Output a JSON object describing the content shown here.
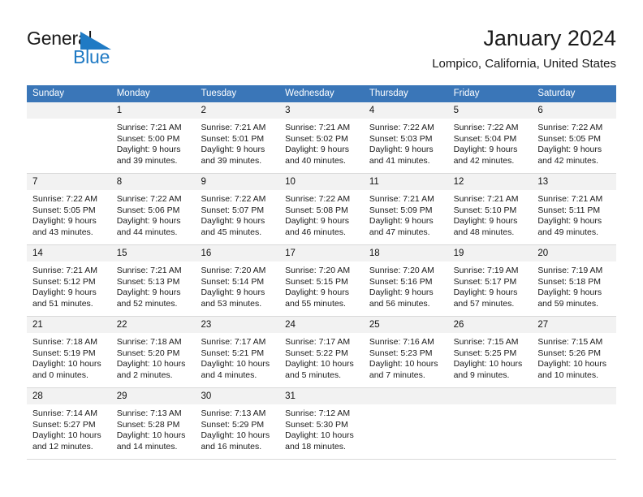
{
  "brand": {
    "name_part1": "General",
    "name_part2": "Blue",
    "logo_icon": "triangle-flag-icon",
    "accent_color": "#1f7ac4"
  },
  "header": {
    "title": "January 2024",
    "location": "Lompico, California, United States"
  },
  "calendar": {
    "header_color": "#3a76b8",
    "daynum_band_color": "#f2f2f2",
    "weekday_headers": [
      "Sunday",
      "Monday",
      "Tuesday",
      "Wednesday",
      "Thursday",
      "Friday",
      "Saturday"
    ],
    "weeks": [
      [
        {
          "day": "",
          "lines": []
        },
        {
          "day": "1",
          "lines": [
            "Sunrise: 7:21 AM",
            "Sunset: 5:00 PM",
            "Daylight: 9 hours",
            "and 39 minutes."
          ]
        },
        {
          "day": "2",
          "lines": [
            "Sunrise: 7:21 AM",
            "Sunset: 5:01 PM",
            "Daylight: 9 hours",
            "and 39 minutes."
          ]
        },
        {
          "day": "3",
          "lines": [
            "Sunrise: 7:21 AM",
            "Sunset: 5:02 PM",
            "Daylight: 9 hours",
            "and 40 minutes."
          ]
        },
        {
          "day": "4",
          "lines": [
            "Sunrise: 7:22 AM",
            "Sunset: 5:03 PM",
            "Daylight: 9 hours",
            "and 41 minutes."
          ]
        },
        {
          "day": "5",
          "lines": [
            "Sunrise: 7:22 AM",
            "Sunset: 5:04 PM",
            "Daylight: 9 hours",
            "and 42 minutes."
          ]
        },
        {
          "day": "6",
          "lines": [
            "Sunrise: 7:22 AM",
            "Sunset: 5:05 PM",
            "Daylight: 9 hours",
            "and 42 minutes."
          ]
        }
      ],
      [
        {
          "day": "7",
          "lines": [
            "Sunrise: 7:22 AM",
            "Sunset: 5:05 PM",
            "Daylight: 9 hours",
            "and 43 minutes."
          ]
        },
        {
          "day": "8",
          "lines": [
            "Sunrise: 7:22 AM",
            "Sunset: 5:06 PM",
            "Daylight: 9 hours",
            "and 44 minutes."
          ]
        },
        {
          "day": "9",
          "lines": [
            "Sunrise: 7:22 AM",
            "Sunset: 5:07 PM",
            "Daylight: 9 hours",
            "and 45 minutes."
          ]
        },
        {
          "day": "10",
          "lines": [
            "Sunrise: 7:22 AM",
            "Sunset: 5:08 PM",
            "Daylight: 9 hours",
            "and 46 minutes."
          ]
        },
        {
          "day": "11",
          "lines": [
            "Sunrise: 7:21 AM",
            "Sunset: 5:09 PM",
            "Daylight: 9 hours",
            "and 47 minutes."
          ]
        },
        {
          "day": "12",
          "lines": [
            "Sunrise: 7:21 AM",
            "Sunset: 5:10 PM",
            "Daylight: 9 hours",
            "and 48 minutes."
          ]
        },
        {
          "day": "13",
          "lines": [
            "Sunrise: 7:21 AM",
            "Sunset: 5:11 PM",
            "Daylight: 9 hours",
            "and 49 minutes."
          ]
        }
      ],
      [
        {
          "day": "14",
          "lines": [
            "Sunrise: 7:21 AM",
            "Sunset: 5:12 PM",
            "Daylight: 9 hours",
            "and 51 minutes."
          ]
        },
        {
          "day": "15",
          "lines": [
            "Sunrise: 7:21 AM",
            "Sunset: 5:13 PM",
            "Daylight: 9 hours",
            "and 52 minutes."
          ]
        },
        {
          "day": "16",
          "lines": [
            "Sunrise: 7:20 AM",
            "Sunset: 5:14 PM",
            "Daylight: 9 hours",
            "and 53 minutes."
          ]
        },
        {
          "day": "17",
          "lines": [
            "Sunrise: 7:20 AM",
            "Sunset: 5:15 PM",
            "Daylight: 9 hours",
            "and 55 minutes."
          ]
        },
        {
          "day": "18",
          "lines": [
            "Sunrise: 7:20 AM",
            "Sunset: 5:16 PM",
            "Daylight: 9 hours",
            "and 56 minutes."
          ]
        },
        {
          "day": "19",
          "lines": [
            "Sunrise: 7:19 AM",
            "Sunset: 5:17 PM",
            "Daylight: 9 hours",
            "and 57 minutes."
          ]
        },
        {
          "day": "20",
          "lines": [
            "Sunrise: 7:19 AM",
            "Sunset: 5:18 PM",
            "Daylight: 9 hours",
            "and 59 minutes."
          ]
        }
      ],
      [
        {
          "day": "21",
          "lines": [
            "Sunrise: 7:18 AM",
            "Sunset: 5:19 PM",
            "Daylight: 10 hours",
            "and 0 minutes."
          ]
        },
        {
          "day": "22",
          "lines": [
            "Sunrise: 7:18 AM",
            "Sunset: 5:20 PM",
            "Daylight: 10 hours",
            "and 2 minutes."
          ]
        },
        {
          "day": "23",
          "lines": [
            "Sunrise: 7:17 AM",
            "Sunset: 5:21 PM",
            "Daylight: 10 hours",
            "and 4 minutes."
          ]
        },
        {
          "day": "24",
          "lines": [
            "Sunrise: 7:17 AM",
            "Sunset: 5:22 PM",
            "Daylight: 10 hours",
            "and 5 minutes."
          ]
        },
        {
          "day": "25",
          "lines": [
            "Sunrise: 7:16 AM",
            "Sunset: 5:23 PM",
            "Daylight: 10 hours",
            "and 7 minutes."
          ]
        },
        {
          "day": "26",
          "lines": [
            "Sunrise: 7:15 AM",
            "Sunset: 5:25 PM",
            "Daylight: 10 hours",
            "and 9 minutes."
          ]
        },
        {
          "day": "27",
          "lines": [
            "Sunrise: 7:15 AM",
            "Sunset: 5:26 PM",
            "Daylight: 10 hours",
            "and 10 minutes."
          ]
        }
      ],
      [
        {
          "day": "28",
          "lines": [
            "Sunrise: 7:14 AM",
            "Sunset: 5:27 PM",
            "Daylight: 10 hours",
            "and 12 minutes."
          ]
        },
        {
          "day": "29",
          "lines": [
            "Sunrise: 7:13 AM",
            "Sunset: 5:28 PM",
            "Daylight: 10 hours",
            "and 14 minutes."
          ]
        },
        {
          "day": "30",
          "lines": [
            "Sunrise: 7:13 AM",
            "Sunset: 5:29 PM",
            "Daylight: 10 hours",
            "and 16 minutes."
          ]
        },
        {
          "day": "31",
          "lines": [
            "Sunrise: 7:12 AM",
            "Sunset: 5:30 PM",
            "Daylight: 10 hours",
            "and 18 minutes."
          ]
        },
        {
          "day": "",
          "lines": []
        },
        {
          "day": "",
          "lines": []
        },
        {
          "day": "",
          "lines": []
        }
      ]
    ]
  }
}
